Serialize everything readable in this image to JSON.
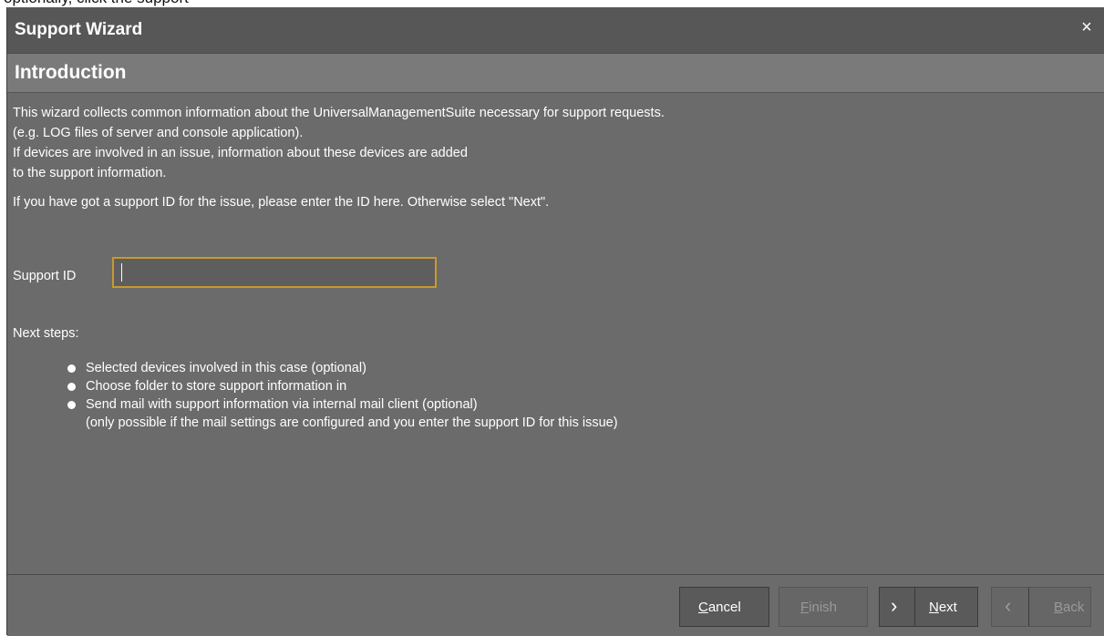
{
  "window": {
    "title": "Support Wizard",
    "close_glyph": "×",
    "partial_text_above": "optionally, click the support"
  },
  "page": {
    "heading": "Introduction"
  },
  "intro": {
    "lines": [
      "This wizard collects common information about the UniversalManagementSuite necessary for support requests.",
      "(e.g. LOG files of server and console application).",
      "If devices are involved in an issue, information about these devices are added",
      "to the support information."
    ],
    "prompt": "If you have got a support ID for the issue, please enter the ID here. Otherwise select \"Next\"."
  },
  "support_id": {
    "label": "Support ID",
    "value": "",
    "placeholder": ""
  },
  "next_steps": {
    "label": "Next steps:",
    "items": [
      "Selected devices involved in this case (optional)",
      "Choose folder to store support information in",
      "Send mail with support information via internal mail client (optional)"
    ],
    "note": "(only possible if the mail settings are configured and you enter the support ID for this issue)"
  },
  "buttons": {
    "cancel": {
      "label": "Cancel",
      "mnemonic": "C",
      "rest": "ancel",
      "enabled": true
    },
    "finish": {
      "label": "Finish",
      "mnemonic": "F",
      "rest": "inish",
      "enabled": false
    },
    "next": {
      "label": "Next",
      "mnemonic": "N",
      "rest": "ext",
      "enabled": true,
      "icon": "chevron-right-icon"
    },
    "back": {
      "label": "Back",
      "mnemonic": "B",
      "rest": "ack",
      "enabled": false,
      "icon": "chevron-left-icon"
    }
  },
  "colors": {
    "dialog_bg": "#6b6b6b",
    "titlebar_bg": "#575757",
    "header_bg": "#7a7a7a",
    "input_focus_border": "#c89a2e"
  }
}
